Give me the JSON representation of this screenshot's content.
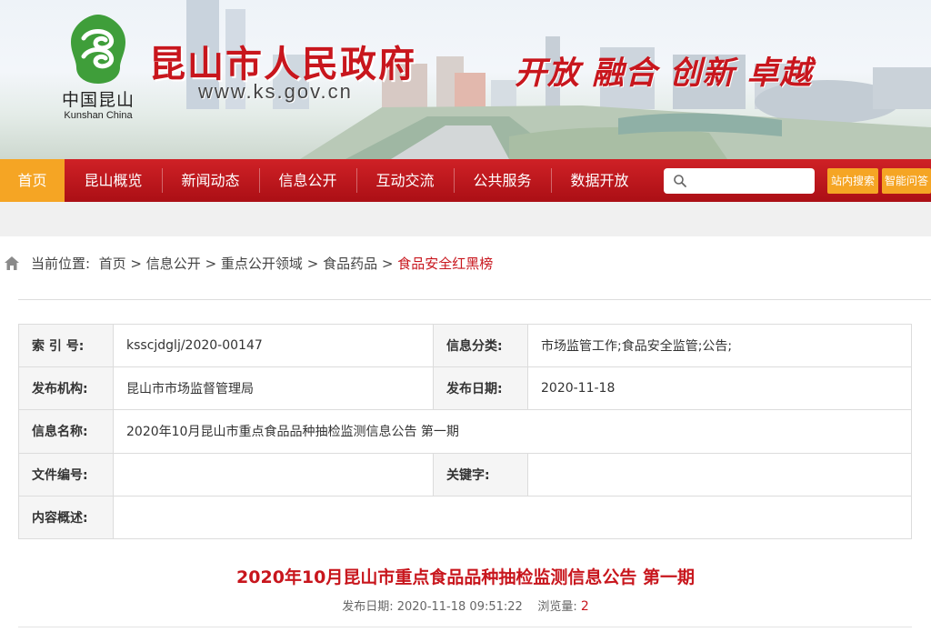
{
  "header": {
    "logo_cn": "中国昆山",
    "logo_en": "Kunshan China",
    "title": "昆山市人民政府",
    "url": "www.ks.gov.cn",
    "slogan": "开放 融合 创新 卓越"
  },
  "nav": {
    "items": [
      {
        "label": "首页",
        "active": true
      },
      {
        "label": "昆山概览"
      },
      {
        "label": "新闻动态"
      },
      {
        "label": "信息公开"
      },
      {
        "label": "互动交流"
      },
      {
        "label": "公共服务"
      },
      {
        "label": "数据开放"
      }
    ],
    "search_value": "",
    "site_search_label": "站内搜索",
    "smart_qa_label": "智能问答"
  },
  "breadcrumb": {
    "prefix": "当前位置:",
    "items": [
      "首页",
      "信息公开",
      "重点公开领域",
      "食品药品"
    ],
    "separator": ">",
    "current": "食品安全红黑榜"
  },
  "info": {
    "index_label": "索 引 号:",
    "index_value": "ksscjdglj/2020-00147",
    "category_label": "信息分类:",
    "category_value": "市场监管工作;食品安全监管;公告;",
    "publisher_label": "发布机构:",
    "publisher_value": "昆山市市场监督管理局",
    "date_label": "发布日期:",
    "date_value": "2020-11-18",
    "name_label": "信息名称:",
    "name_value": "2020年10月昆山市重点食品品种抽检监测信息公告 第一期",
    "docno_label": "文件编号:",
    "docno_value": "",
    "keywords_label": "关键字:",
    "keywords_value": "",
    "summary_label": "内容概述:",
    "summary_value": ""
  },
  "article": {
    "title": "2020年10月昆山市重点食品品种抽检监测信息公告 第一期",
    "date_label": "发布日期:",
    "date_value": "2020-11-18 09:51:22",
    "views_label": "浏览量:",
    "views_value": "2"
  },
  "colors": {
    "brand_red": "#c8161d",
    "nav_red": "#b81219",
    "accent_orange": "#f5a524"
  },
  "icons": [
    "emblem-logo",
    "search-icon",
    "home-icon"
  ]
}
